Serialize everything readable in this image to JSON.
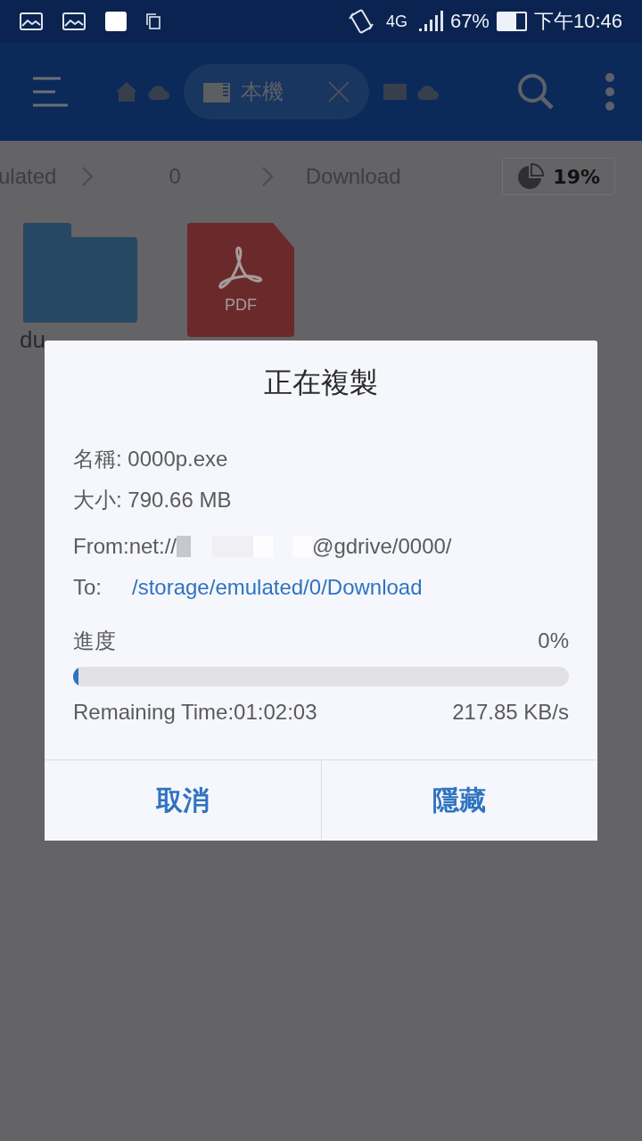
{
  "status_bar": {
    "network": "4G",
    "battery": "67%",
    "time": "下午10:46"
  },
  "toolbar": {
    "tab": "本機"
  },
  "breadcrumbs": [
    "ulated",
    "0",
    "Download"
  ],
  "storage": {
    "percent": "19%"
  },
  "files": [
    {
      "kind": "folder",
      "name_lines": [
        "du"
      ]
    },
    {
      "kind": "pdf",
      "badge": "PDF"
    }
  ],
  "dialog": {
    "title": "正在複製",
    "name": "名稱: 0000p.exe",
    "size": "大小: 790.66 MB",
    "from": {
      "prefix": "From:net://",
      "suffix": "@gdrive/0000/"
    },
    "to": {
      "label": "To:",
      "path": "/storage/emulated/0/Download"
    },
    "progress": {
      "label": "進度",
      "percent": "0%",
      "level": 0.01
    },
    "remaining": "Remaining Time:01:02:03",
    "speed": "217.85 KB/s",
    "buttons": [
      "取消",
      "隱藏"
    ]
  }
}
